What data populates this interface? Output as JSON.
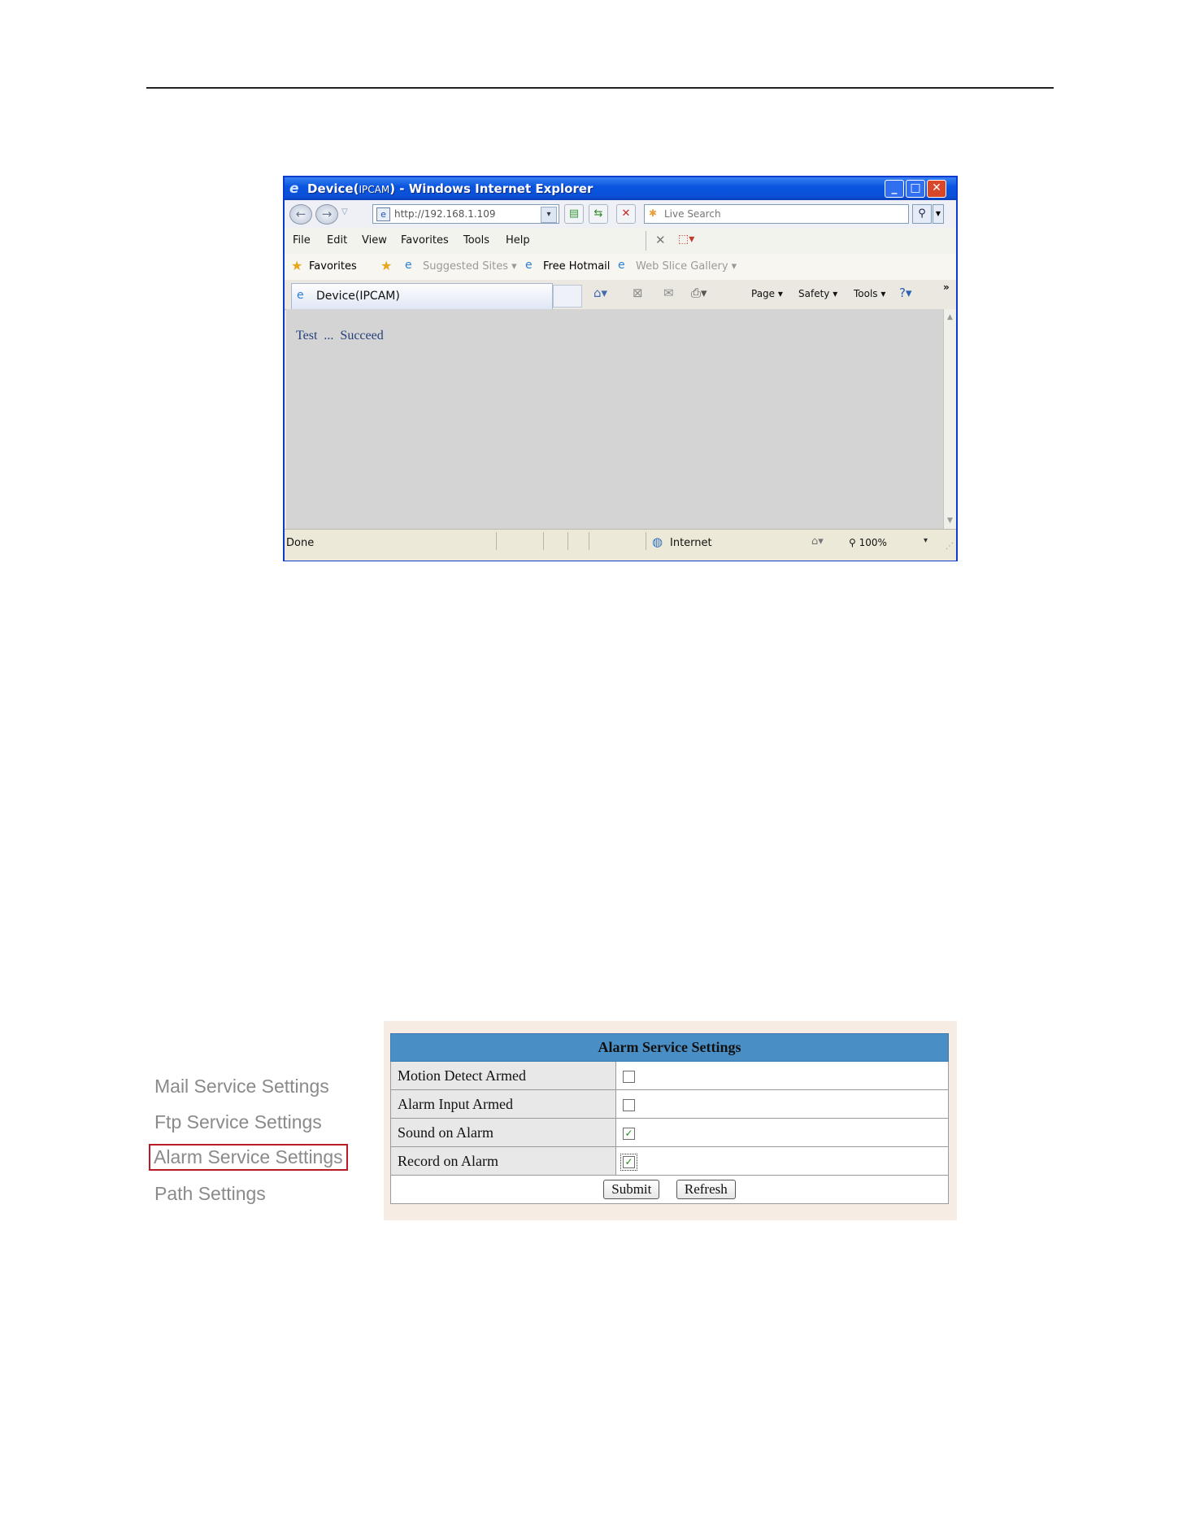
{
  "window": {
    "title": "Device(IPCAM) - Windows Internet Explorer",
    "title_pre": "Device(",
    "title_ipcam": "IPCAM",
    "title_post": ") - Windows Internet Explorer",
    "controls": [
      "minimize",
      "maximize",
      "close"
    ]
  },
  "navbar": {
    "address": "http://192.168.1.109",
    "search_placeholder": "Live Search"
  },
  "menu": {
    "items": [
      "File",
      "Edit",
      "View",
      "Favorites",
      "Tools",
      "Help"
    ]
  },
  "favorites_bar": {
    "favorites_label": "Favorites",
    "suggested_sites": "Suggested Sites",
    "free_hotmail": "Free Hotmail",
    "web_slice_gallery": "Web Slice Gallery"
  },
  "tab": {
    "label": "Device(IPCAM)"
  },
  "command_bar": {
    "page": "Page",
    "safety": "Safety",
    "tools": "Tools",
    "overflow": "»"
  },
  "content": {
    "message": "Test  ...  Succeed"
  },
  "statusbar": {
    "status": "Done",
    "zone": "Internet",
    "zoom": "100%"
  },
  "settings_nav": {
    "items": [
      {
        "label": "Mail Service Settings",
        "active": false
      },
      {
        "label": "Ftp Service Settings",
        "active": false
      },
      {
        "label": "Alarm Service Settings",
        "active": true
      },
      {
        "label": "Path Settings",
        "active": false
      }
    ]
  },
  "alarm_settings": {
    "title": "Alarm Service Settings",
    "rows": [
      {
        "label": "Motion Detect Armed",
        "checked": false
      },
      {
        "label": "Alarm Input Armed",
        "checked": false
      },
      {
        "label": "Sound on Alarm",
        "checked": true
      },
      {
        "label": "Record on Alarm",
        "checked": true
      }
    ],
    "submit_label": "Submit",
    "refresh_label": "Refresh"
  },
  "colors": {
    "titlebar": "#0b4fd6",
    "table_header": "#4a8ec6",
    "panel_bg": "#f7ece4",
    "active_border": "#b81c24"
  }
}
